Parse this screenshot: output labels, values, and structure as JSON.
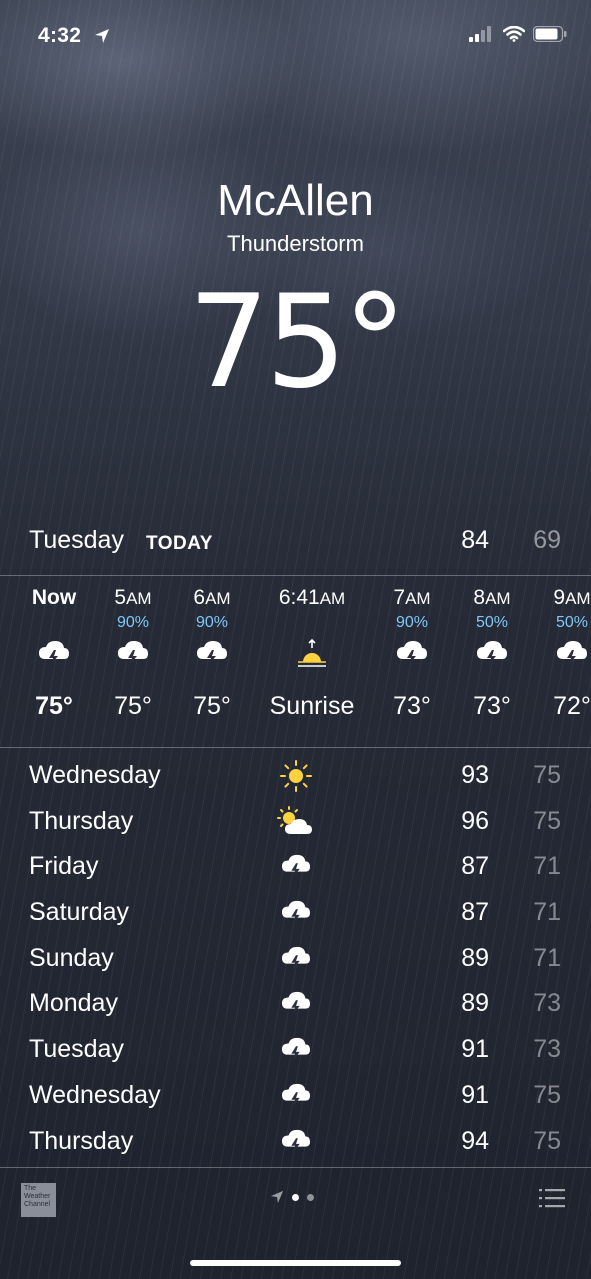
{
  "status_bar": {
    "time": "4:32"
  },
  "header": {
    "city": "McAllen",
    "condition": "Thunderstorm",
    "temperature": "75°"
  },
  "today": {
    "day": "Tuesday",
    "tag": "TODAY",
    "high": "84",
    "low": "69"
  },
  "hourly": [
    {
      "label": "Now",
      "suffix": "",
      "precip": "",
      "icon": "thunderstorm-icon",
      "temp": "75°",
      "bold": true
    },
    {
      "label": "5",
      "suffix": "AM",
      "precip": "90%",
      "icon": "thunderstorm-icon",
      "temp": "75°"
    },
    {
      "label": "6",
      "suffix": "AM",
      "precip": "90%",
      "icon": "thunderstorm-icon",
      "temp": "75°"
    },
    {
      "label": "6:41",
      "suffix": "AM",
      "precip": "",
      "icon": "sunrise-icon",
      "temp": "Sunrise"
    },
    {
      "label": "7",
      "suffix": "AM",
      "precip": "90%",
      "icon": "thunderstorm-icon",
      "temp": "73°"
    },
    {
      "label": "8",
      "suffix": "AM",
      "precip": "50%",
      "icon": "thunderstorm-icon",
      "temp": "73°"
    },
    {
      "label": "9",
      "suffix": "AM",
      "precip": "50%",
      "icon": "thunderstorm-icon",
      "temp": "72°"
    }
  ],
  "daily": [
    {
      "day": "Wednesday",
      "icon": "sun-icon",
      "high": "93",
      "low": "75"
    },
    {
      "day": "Thursday",
      "icon": "partly-sunny-icon",
      "high": "96",
      "low": "75"
    },
    {
      "day": "Friday",
      "icon": "thunderstorm-icon",
      "high": "87",
      "low": "71"
    },
    {
      "day": "Saturday",
      "icon": "thunderstorm-icon",
      "high": "87",
      "low": "71"
    },
    {
      "day": "Sunday",
      "icon": "thunderstorm-icon",
      "high": "89",
      "low": "71"
    },
    {
      "day": "Monday",
      "icon": "thunderstorm-icon",
      "high": "89",
      "low": "73"
    },
    {
      "day": "Tuesday",
      "icon": "thunderstorm-icon",
      "high": "91",
      "low": "73"
    },
    {
      "day": "Wednesday",
      "icon": "thunderstorm-icon",
      "high": "91",
      "low": "75"
    },
    {
      "day": "Thursday",
      "icon": "thunderstorm-icon",
      "high": "94",
      "low": "75"
    }
  ],
  "footer": {
    "logo_text": "The Weather Channel",
    "page_count": 2,
    "active_page": 0
  },
  "colors": {
    "precip": "#7fc8f8",
    "sun": "#ffd23f"
  }
}
